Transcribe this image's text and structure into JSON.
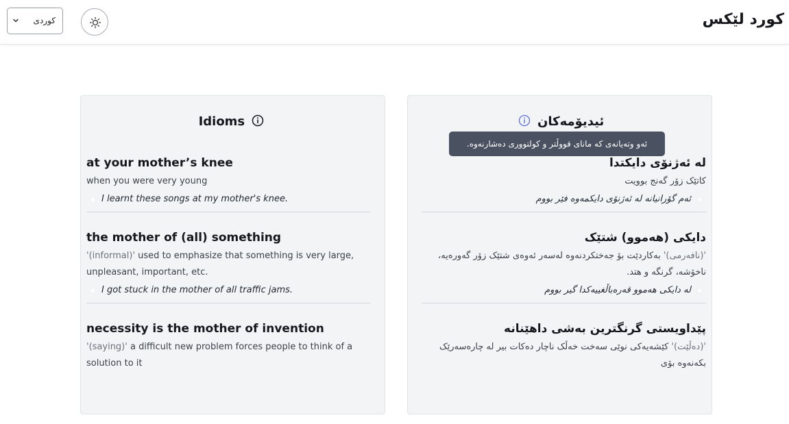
{
  "header": {
    "brand": "کورد لێکس",
    "language": {
      "selected": "کوردی"
    },
    "theme_icon": "sun-icon"
  },
  "english_panel": {
    "title": "Idioms",
    "entries": [
      {
        "phrase": "at your mother’s knee",
        "usage": "",
        "definition": "when you were very young",
        "example": "I learnt these songs at my mother's knee."
      },
      {
        "phrase": "the mother of (all) something",
        "usage": "'(informal)'",
        "definition": "used to emphasize that something is very large, unpleasant, important, etc.",
        "example": "I got stuck in the mother of all traffic jams."
      },
      {
        "phrase": "necessity is the mother of invention",
        "usage": "'(saying)'",
        "definition": "a difficult new problem forces people to think of a solution to it",
        "example": ""
      }
    ]
  },
  "kurdish_panel": {
    "title": "ئیدیۆمەکان",
    "tooltip": "ئەو وتەیانەی کە مانای قووڵتر و کولتووری دەشارنەوە.",
    "entries": [
      {
        "phrase": "لە ئەژنۆی دایکتدا",
        "usage": "",
        "definition": "کاتێک زۆر گەنج بوویت",
        "example": "ئەم گۆرانیانە لە ئەژنۆی دایکمەوە فێر بووم"
      },
      {
        "phrase": "دایکی (هەموو) شتێک",
        "usage": "'(نافەرمی)'",
        "definition": "بەکاردێت بۆ جەختکردنەوە لەسەر ئەوەی شتێک زۆر گەورەیە، ناخۆشە، گرنگە و هتد.",
        "example": "لە دایکی هەموو قەرەباڵغییەکدا گیر بووم"
      },
      {
        "phrase": "پێداویستی گرنگترین بەشی داهێنانە",
        "usage": "'(دەڵێت)'",
        "definition": "کێشەیەکی نوێی سەخت خەڵک ناچار دەکات بیر لە چارەسەرێک بکەنەوە بۆی",
        "example": ""
      }
    ]
  },
  "colors": {
    "card_bg": "#f3f4f6",
    "tooltip_bg": "#4a5160",
    "info_accent": "#5b6ee1"
  }
}
